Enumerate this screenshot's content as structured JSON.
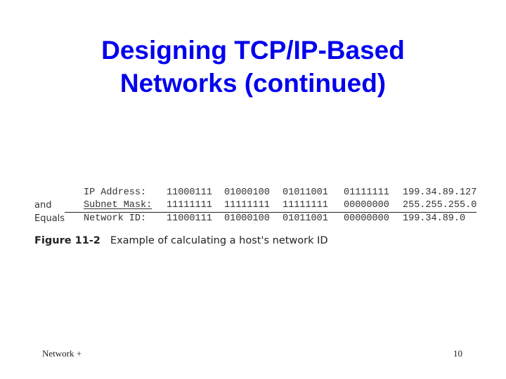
{
  "slide": {
    "title_lines": [
      "Designing TCP/IP-Based",
      "Networks (continued)"
    ],
    "title_color": "#0000ee"
  },
  "figure": {
    "rows": [
      {
        "prefix": "",
        "label": "IP Address:",
        "octets": [
          "11000111",
          "01000100",
          "01011001",
          "01111111"
        ],
        "decimal": "199.34.89.127"
      },
      {
        "prefix": "and",
        "label": "Subnet Mask:",
        "octets": [
          "11111111",
          "11111111",
          "11111111",
          "00000000"
        ],
        "decimal": "255.255.255.0"
      },
      {
        "prefix": "Equals",
        "label": "Network ID:",
        "octets": [
          "11000111",
          "01000100",
          "01011001",
          "00000000"
        ],
        "decimal": "199.34.89.0"
      }
    ],
    "caption_label": "Figure 11-2",
    "caption_text": "Example of calculating a host's network ID"
  },
  "footer": {
    "left": "Network +",
    "page_number": "10"
  }
}
